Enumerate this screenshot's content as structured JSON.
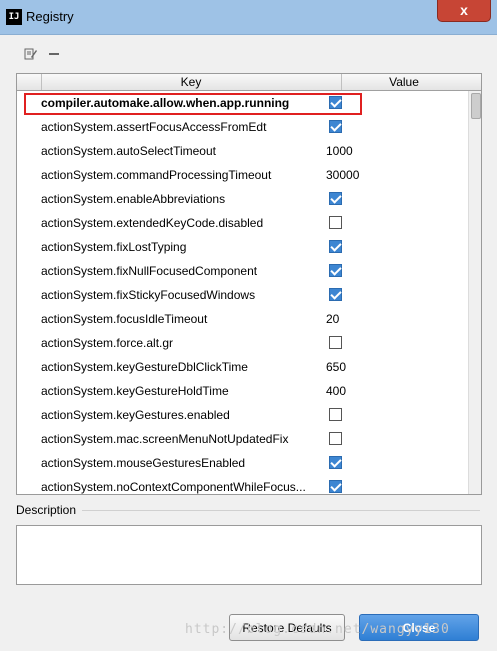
{
  "window": {
    "title": "Registry",
    "app_icon": "IJ",
    "close_glyph": "x",
    "colors": {
      "titlebar": "#9ec2e6",
      "close": "#c74535",
      "accent": "#3d86d2"
    }
  },
  "toolbar": {
    "edit_icon": "edit-icon",
    "remove_icon": "minus-icon"
  },
  "table": {
    "headers": {
      "key": "Key",
      "value": "Value"
    },
    "rows": [
      {
        "key": "compiler.automake.allow.when.app.running",
        "type": "checkbox",
        "checked": true,
        "bold": true
      },
      {
        "key": "actionSystem.assertFocusAccessFromEdt",
        "type": "checkbox",
        "checked": true
      },
      {
        "key": "actionSystem.autoSelectTimeout",
        "type": "text",
        "value": "1000"
      },
      {
        "key": "actionSystem.commandProcessingTimeout",
        "type": "text",
        "value": "30000"
      },
      {
        "key": "actionSystem.enableAbbreviations",
        "type": "checkbox",
        "checked": true
      },
      {
        "key": "actionSystem.extendedKeyCode.disabled",
        "type": "checkbox",
        "checked": false
      },
      {
        "key": "actionSystem.fixLostTyping",
        "type": "checkbox",
        "checked": true
      },
      {
        "key": "actionSystem.fixNullFocusedComponent",
        "type": "checkbox",
        "checked": true
      },
      {
        "key": "actionSystem.fixStickyFocusedWindows",
        "type": "checkbox",
        "checked": true
      },
      {
        "key": "actionSystem.focusIdleTimeout",
        "type": "text",
        "value": "20"
      },
      {
        "key": "actionSystem.force.alt.gr",
        "type": "checkbox",
        "checked": false
      },
      {
        "key": "actionSystem.keyGestureDblClickTime",
        "type": "text",
        "value": "650"
      },
      {
        "key": "actionSystem.keyGestureHoldTime",
        "type": "text",
        "value": "400"
      },
      {
        "key": "actionSystem.keyGestures.enabled",
        "type": "checkbox",
        "checked": false
      },
      {
        "key": "actionSystem.mac.screenMenuNotUpdatedFix",
        "type": "checkbox",
        "checked": false
      },
      {
        "key": "actionSystem.mouseGesturesEnabled",
        "type": "checkbox",
        "checked": true
      },
      {
        "key": "actionSystem.noContextComponentWhileFocus...",
        "type": "checkbox",
        "checked": true
      }
    ]
  },
  "description": {
    "label": "Description",
    "text": ""
  },
  "buttons": {
    "restore": "Restore Defaults",
    "close": "Close"
  },
  "watermark": "http://blog.csdn.net/wangyy130"
}
